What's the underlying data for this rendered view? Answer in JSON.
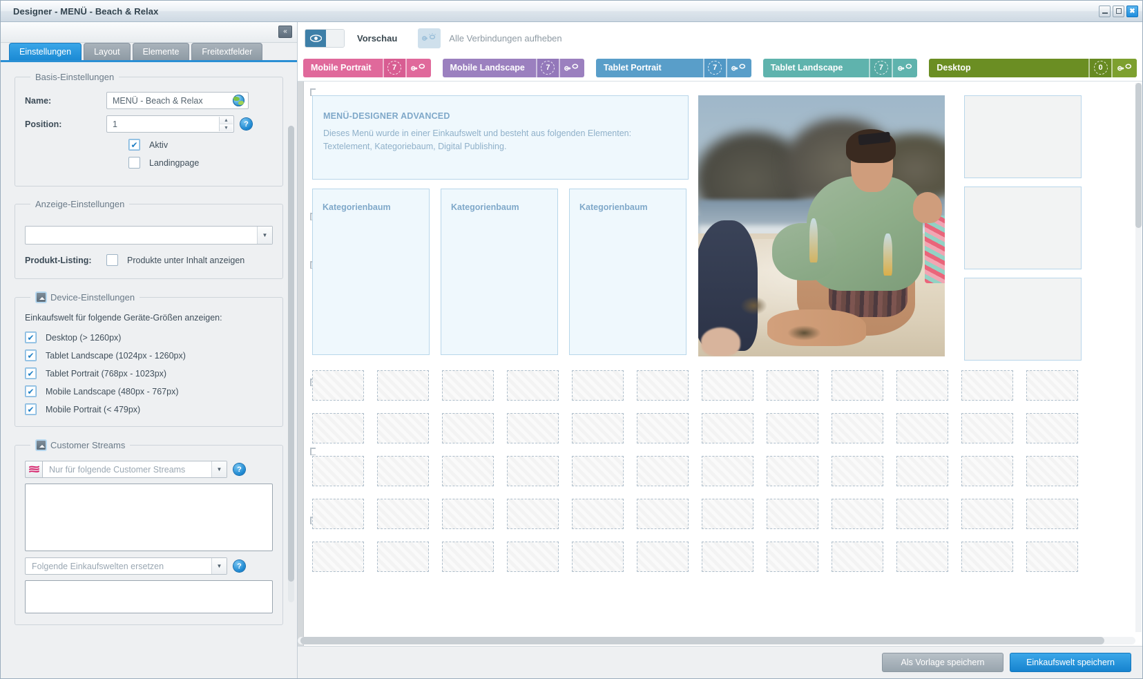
{
  "window": {
    "title": "Designer - MENÜ - Beach & Relax",
    "controls": {
      "minimize": "minimize-icon",
      "maximize": "maximize-icon",
      "close": "✖"
    }
  },
  "left": {
    "collapse_label": "«",
    "tabs": [
      {
        "label": "Einstellungen",
        "active": true
      },
      {
        "label": "Layout",
        "active": false
      },
      {
        "label": "Elemente",
        "active": false
      },
      {
        "label": "Freitextfelder",
        "active": false
      }
    ],
    "basis": {
      "legend": "Basis-Einstellungen",
      "name_label": "Name:",
      "name_value": "MENÜ - Beach & Relax",
      "position_label": "Position:",
      "position_value": "1",
      "help": "?",
      "aktiv_label": "Aktiv",
      "aktiv_checked": true,
      "landingpage_label": "Landingpage",
      "landingpage_checked": false
    },
    "anzeige": {
      "legend": "Anzeige-Einstellungen",
      "select_value": "",
      "produkt_listing_label": "Produkt-Listing:",
      "produkt_checkbox_label": "Produkte unter Inhalt anzeigen",
      "produkt_checked": false
    },
    "device": {
      "legend": "Device-Einstellungen",
      "intro": "Einkaufswelt für folgende Geräte-Größen anzeigen:",
      "items": [
        {
          "label": "Desktop (> 1260px)",
          "checked": true
        },
        {
          "label": "Tablet Landscape (1024px - 1260px)",
          "checked": true
        },
        {
          "label": "Tablet Portrait (768px - 1023px)",
          "checked": true
        },
        {
          "label": "Mobile Landscape (480px - 767px)",
          "checked": true
        },
        {
          "label": "Mobile Portrait (< 479px)",
          "checked": true
        }
      ]
    },
    "streams": {
      "legend": "Customer Streams",
      "stream_select_placeholder": "Nur für folgende Customer Streams",
      "replace_select_placeholder": "Folgende Einkaufswelten ersetzen",
      "help": "?"
    }
  },
  "toolbar": {
    "preview_label": "Vorschau",
    "preview_on": true,
    "unlink_label": "Alle Verbindungen aufheben"
  },
  "devices": [
    {
      "name": "Mobile Portrait",
      "count": "7",
      "color": "#e0699b",
      "count_bg": "#d85d92",
      "link_bg": "#e0699b"
    },
    {
      "name": "Mobile Landscape",
      "count": "7",
      "color": "#9b80bf",
      "count_bg": "#9378ba",
      "link_bg": "#9b80bf"
    },
    {
      "name": "Tablet Portrait",
      "count": "7",
      "color": "#599ec9",
      "count_bg": "#5097c5",
      "link_bg": "#599ec9"
    },
    {
      "name": "Tablet Landscape",
      "count": "7",
      "color": "#5fb3ad",
      "count_bg": "#57aaa4",
      "link_bg": "#5fb3ad"
    },
    {
      "name": "Desktop",
      "count": "0",
      "color": "#6b8e23",
      "count_bg": "#678a21",
      "link_bg": "#7da02f"
    }
  ],
  "canvas": {
    "text_element": {
      "heading": "MENÜ-DESIGNER ADVANCED",
      "body": "Dieses Menü wurde in einer Einkaufswelt und besteht aus folgenden Elementen: Textelement, Kategoriebaum, Digital Publishing."
    },
    "category_boxes": [
      "Kategorienbaum",
      "Kategorienbaum",
      "Kategorienbaum"
    ],
    "image_alt": "beach-photo",
    "side_boxes_count": 3,
    "placeholder_rows": 5,
    "placeholder_cols": 12
  },
  "footer": {
    "save_template": "Als Vorlage speichern",
    "save_world": "Einkaufswelt speichern"
  }
}
